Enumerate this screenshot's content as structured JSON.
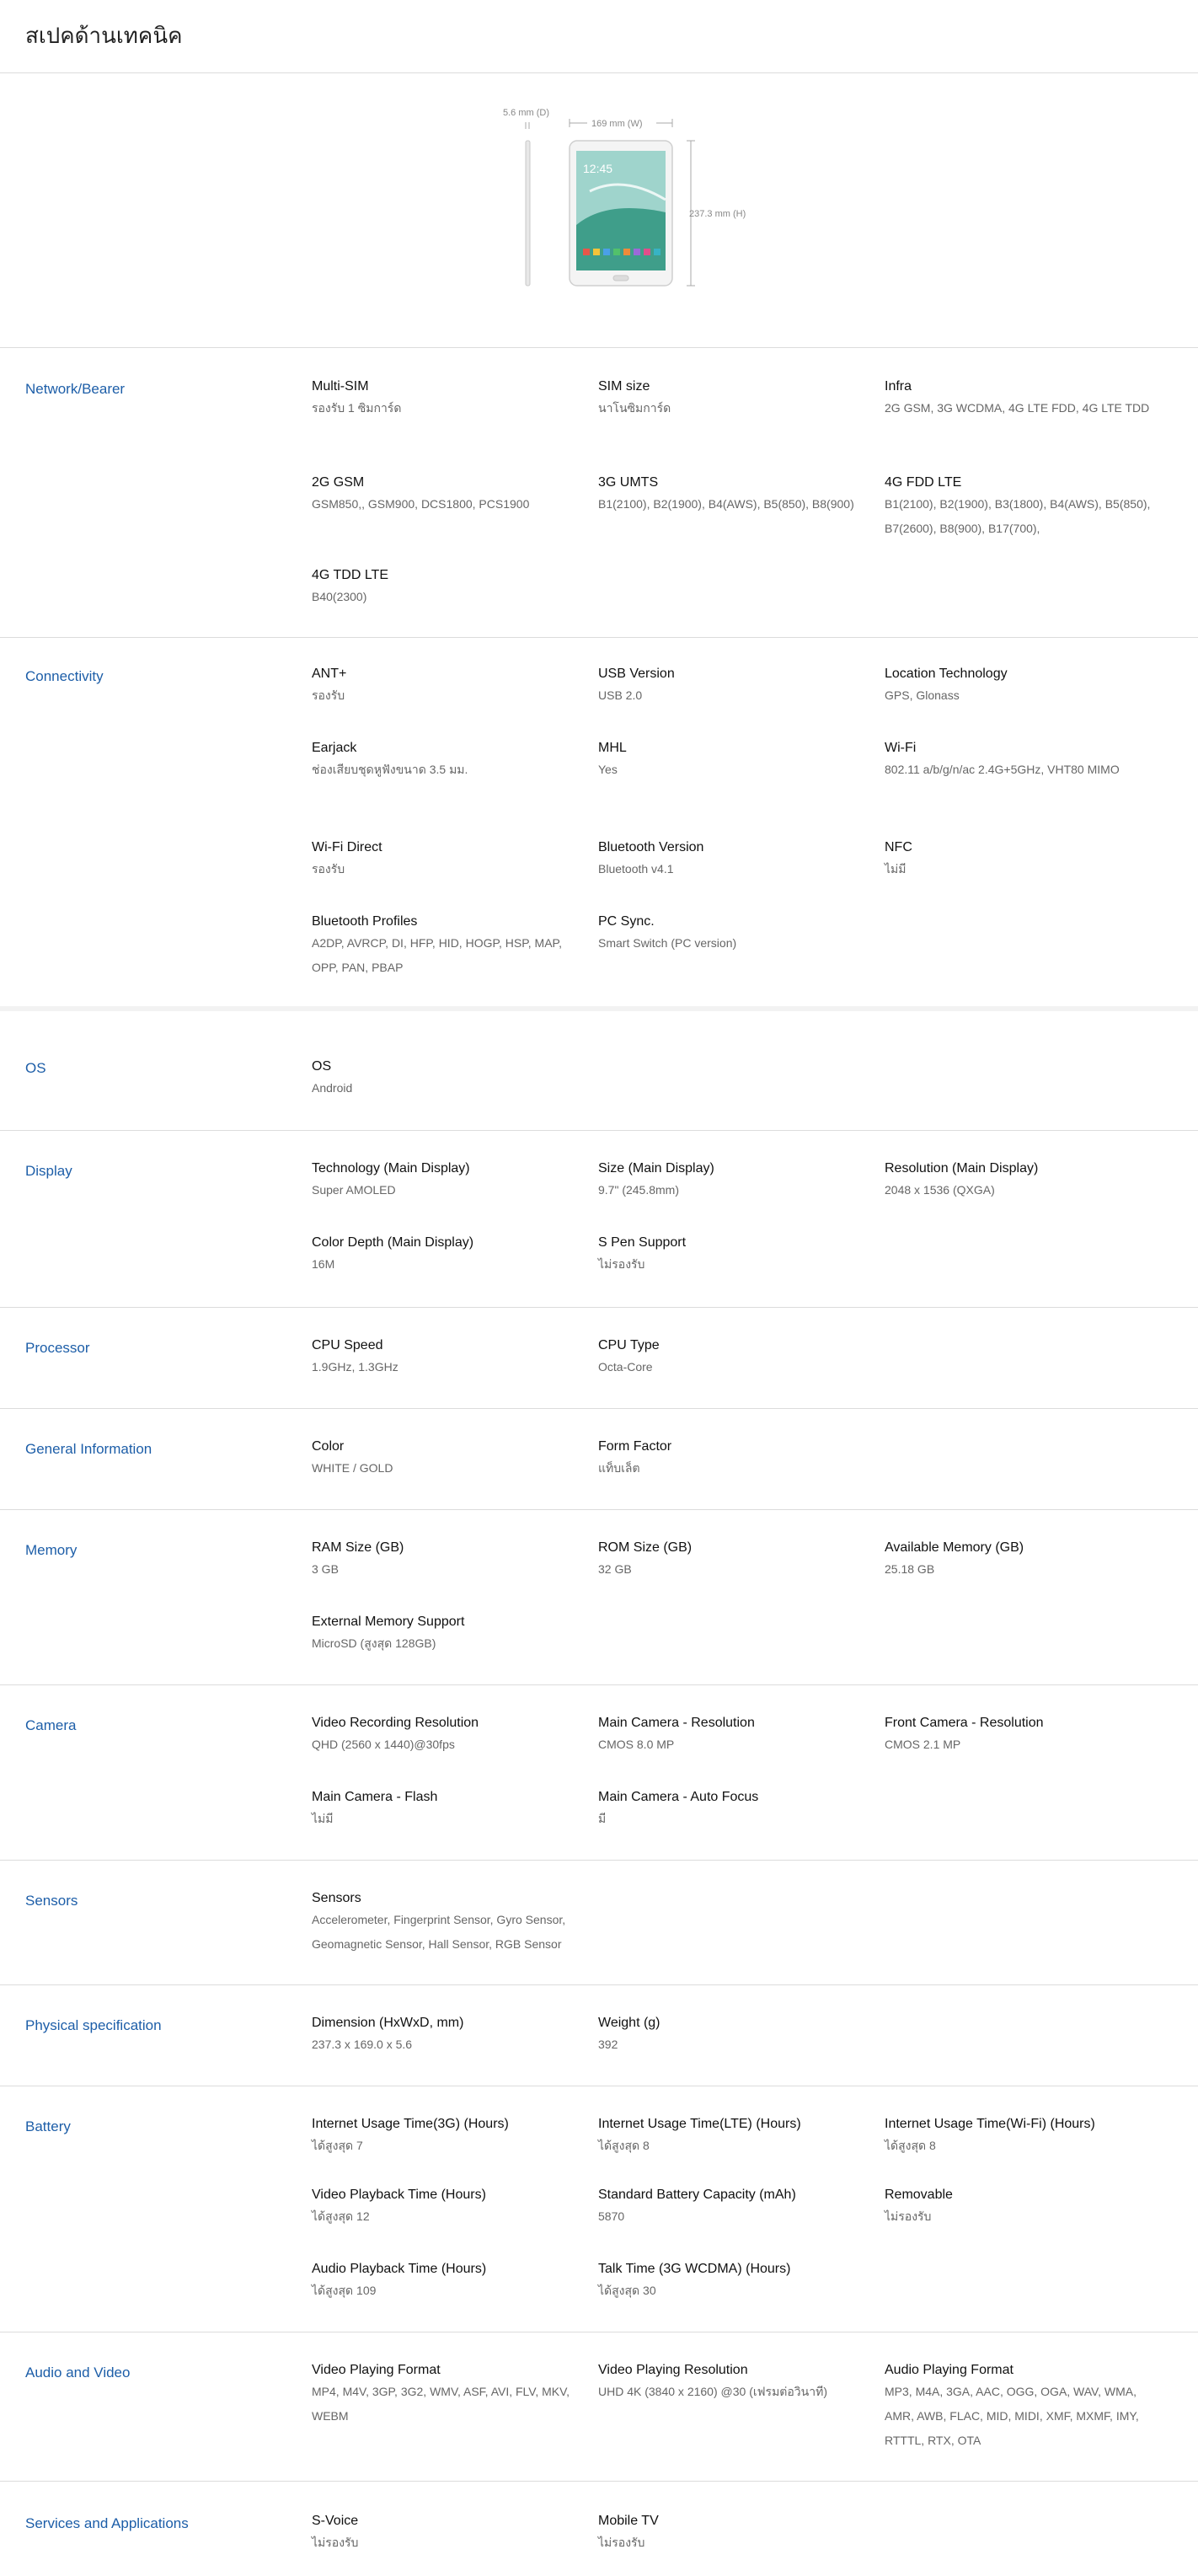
{
  "page": {
    "title": "สเปคด้านเทคนิค"
  },
  "device_image": {
    "depth_label": "5.6 mm (D)",
    "width_label": "169 mm (W)",
    "height_label": "237.3 mm (H)",
    "screen_time": "12:45"
  },
  "sections": [
    {
      "title": "Network/Bearer",
      "specs": [
        {
          "label": "Multi-SIM",
          "value": "รองรับ 1 ซิมการ์ด"
        },
        {
          "label": "SIM size",
          "value": "นาโนซิมการ์ด"
        },
        {
          "label": "Infra",
          "value": "2G GSM, 3G WCDMA, 4G LTE FDD, 4G LTE TDD"
        },
        {
          "label": "2G GSM",
          "value": "GSM850,, GSM900, DCS1800, PCS1900"
        },
        {
          "label": "3G UMTS",
          "value": "B1(2100), B2(1900), B4(AWS), B5(850), B8(900)"
        },
        {
          "label": "4G FDD LTE",
          "value": "B1(2100), B2(1900), B3(1800), B4(AWS), B5(850), B7(2600), B8(900), B17(700),"
        },
        {
          "label": "4G TDD LTE",
          "value": "B40(2300)"
        }
      ]
    },
    {
      "title": "Connectivity",
      "specs": [
        {
          "label": "ANT+",
          "value": "รองรับ"
        },
        {
          "label": "USB Version",
          "value": "USB 2.0"
        },
        {
          "label": "Location Technology",
          "value": "GPS, Glonass"
        },
        {
          "label": "Earjack",
          "value": "ช่องเสียบชุดหูฟังขนาด 3.5 มม."
        },
        {
          "label": "MHL",
          "value": "Yes"
        },
        {
          "label": "Wi-Fi",
          "value": "802.11 a/b/g/n/ac 2.4G+5GHz, VHT80 MIMO"
        },
        {
          "label": "Wi-Fi Direct",
          "value": "รองรับ"
        },
        {
          "label": "Bluetooth Version",
          "value": "Bluetooth v4.1"
        },
        {
          "label": "NFC",
          "value": "ไม่มี"
        },
        {
          "label": "Bluetooth Profiles",
          "value": "A2DP, AVRCP, DI, HFP, HID, HOGP, HSP, MAP, OPP, PAN, PBAP"
        },
        {
          "label": "PC Sync.",
          "value": "Smart Switch (PC version)"
        }
      ]
    },
    {
      "title": "OS",
      "specs": [
        {
          "label": "OS",
          "value": "Android"
        }
      ]
    },
    {
      "title": "Display",
      "specs": [
        {
          "label": "Technology (Main Display)",
          "value": "Super AMOLED"
        },
        {
          "label": "Size (Main Display)",
          "value": "9.7\" (245.8mm)"
        },
        {
          "label": "Resolution (Main Display)",
          "value": "2048 x 1536 (QXGA)"
        },
        {
          "label": "Color Depth (Main Display)",
          "value": "16M"
        },
        {
          "label": "S Pen Support",
          "value": "ไม่รองรับ"
        }
      ]
    },
    {
      "title": "Processor",
      "specs": [
        {
          "label": "CPU Speed",
          "value": "1.9GHz, 1.3GHz"
        },
        {
          "label": "CPU Type",
          "value": "Octa-Core"
        }
      ]
    },
    {
      "title": "General Information",
      "specs": [
        {
          "label": "Color",
          "value": "WHITE / GOLD"
        },
        {
          "label": "Form Factor",
          "value": "แท็บเล็ต"
        }
      ]
    },
    {
      "title": "Memory",
      "specs": [
        {
          "label": "RAM Size (GB)",
          "value": "3 GB"
        },
        {
          "label": "ROM Size (GB)",
          "value": "32 GB"
        },
        {
          "label": "Available Memory (GB)",
          "value": "25.18 GB"
        },
        {
          "label": "External Memory Support",
          "value": "MicroSD (สูงสุด 128GB)"
        }
      ]
    },
    {
      "title": "Camera",
      "specs": [
        {
          "label": "Video Recording Resolution",
          "value": "QHD (2560 x 1440)@30fps"
        },
        {
          "label": "Main Camera - Resolution",
          "value": "CMOS 8.0 MP"
        },
        {
          "label": "Front Camera - Resolution",
          "value": "CMOS 2.1 MP"
        },
        {
          "label": "Main Camera - Flash",
          "value": "ไม่มี"
        },
        {
          "label": "Main Camera - Auto Focus",
          "value": "มี"
        }
      ]
    },
    {
      "title": "Sensors",
      "specs": [
        {
          "label": "Sensors",
          "value": "Accelerometer, Fingerprint Sensor, Gyro Sensor, Geomagnetic Sensor, Hall Sensor, RGB Sensor"
        }
      ]
    },
    {
      "title": "Physical specification",
      "specs": [
        {
          "label": "Dimension (HxWxD, mm)",
          "value": "237.3 x 169.0 x 5.6"
        },
        {
          "label": "Weight (g)",
          "value": "392"
        }
      ]
    },
    {
      "title": "Battery",
      "specs": [
        {
          "label": "Internet Usage Time(3G) (Hours)",
          "value": "ได้สูงสุด 7"
        },
        {
          "label": "Internet Usage Time(LTE) (Hours)",
          "value": "ได้สูงสุด 8"
        },
        {
          "label": "Internet Usage Time(Wi-Fi) (Hours)",
          "value": "ได้สูงสุด 8"
        },
        {
          "label": "Video Playback Time (Hours)",
          "value": "ได้สูงสุด 12"
        },
        {
          "label": "Standard Battery Capacity (mAh)",
          "value": "5870"
        },
        {
          "label": "Removable",
          "value": "ไม่รองรับ"
        },
        {
          "label": "Audio Playback Time (Hours)",
          "value": "ได้สูงสุด 109"
        },
        {
          "label": "Talk Time (3G WCDMA) (Hours)",
          "value": "ได้สูงสุด 30"
        }
      ]
    },
    {
      "title": "Audio and Video",
      "specs": [
        {
          "label": "Video Playing Format",
          "value": "MP4, M4V, 3GP, 3G2, WMV, ASF, AVI, FLV, MKV, WEBM"
        },
        {
          "label": "Video Playing Resolution",
          "value": "UHD 4K (3840 x 2160) @30 (เฟรมต่อวินาที)"
        },
        {
          "label": "Audio Playing Format",
          "value": "MP3, M4A, 3GA, AAC, OGG, OGA, WAV, WMA, AMR, AWB, FLAC, MID, MIDI, XMF, MXMF, IMY, RTTTL, RTX, OTA"
        }
      ]
    },
    {
      "title": "Services and Applications",
      "specs": [
        {
          "label": "S-Voice",
          "value": "ไม่รองรับ"
        },
        {
          "label": "Mobile TV",
          "value": "ไม่รองรับ"
        }
      ]
    }
  ]
}
